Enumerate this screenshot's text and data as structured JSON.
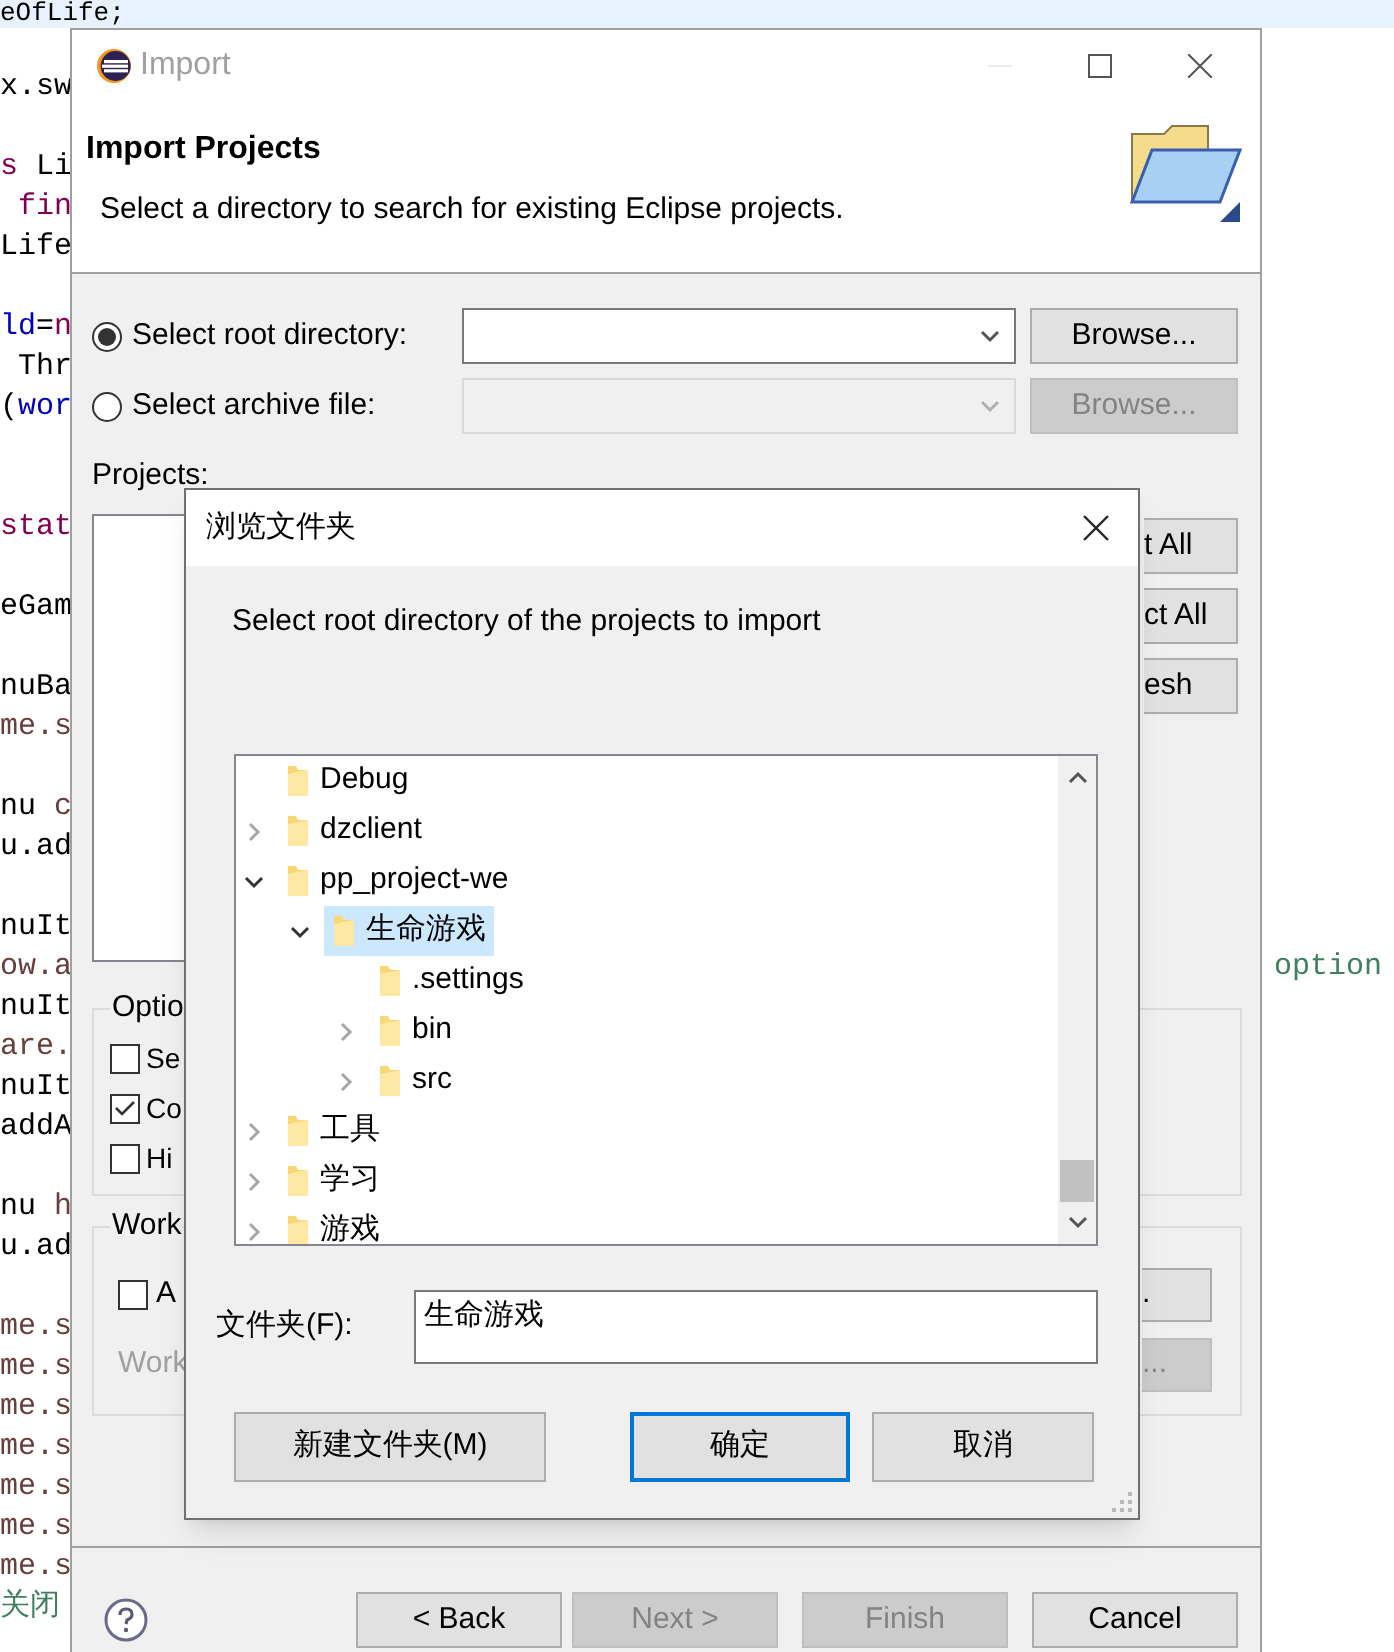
{
  "editor": {
    "lines": [
      {
        "kind": "code",
        "highlighted": true,
        "tokens": [
          {
            "text": "eOfLife;",
            "color": "#000000"
          }
        ]
      },
      {
        "kind": "blank"
      },
      {
        "kind": "code",
        "highlighted": false,
        "tokens": [
          {
            "text": "x.sw",
            "color": "#000000"
          }
        ]
      },
      {
        "kind": "blank"
      },
      {
        "kind": "code",
        "highlighted": false,
        "tokens": [
          {
            "text": "s",
            "color": "#7f0055"
          },
          {
            "text": " Li",
            "color": "#000000"
          }
        ]
      },
      {
        "kind": "code",
        "highlighted": false,
        "tokens": [
          {
            "text": " fin",
            "color": "#7f0055"
          }
        ]
      },
      {
        "kind": "code",
        "highlighted": false,
        "tokens": [
          {
            "text": "Life",
            "color": "#000000"
          }
        ]
      },
      {
        "kind": "blank"
      },
      {
        "kind": "code",
        "highlighted": false,
        "tokens": [
          {
            "text": "ld",
            "color": "#0000c0"
          },
          {
            "text": "=",
            "color": "#000000"
          },
          {
            "text": "n",
            "color": "#7f0055"
          }
        ]
      },
      {
        "kind": "code",
        "highlighted": false,
        "tokens": [
          {
            "text": " Thr",
            "color": "#000000"
          }
        ]
      },
      {
        "kind": "code",
        "highlighted": false,
        "tokens": [
          {
            "text": "(",
            "color": "#000000"
          },
          {
            "text": "wor",
            "color": "#0000c0"
          }
        ]
      },
      {
        "kind": "blank"
      },
      {
        "kind": "blank"
      },
      {
        "kind": "code",
        "highlighted": false,
        "tokens": [
          {
            "text": "stat",
            "color": "#7f0055"
          }
        ]
      },
      {
        "kind": "blank"
      },
      {
        "kind": "code",
        "highlighted": false,
        "tokens": [
          {
            "text": "eGam",
            "color": "#000000"
          }
        ]
      },
      {
        "kind": "blank"
      },
      {
        "kind": "code",
        "highlighted": false,
        "tokens": [
          {
            "text": "nuBa",
            "color": "#000000"
          }
        ]
      },
      {
        "kind": "code",
        "highlighted": false,
        "tokens": [
          {
            "text": "me.s",
            "color": "#6a3e3e"
          }
        ]
      },
      {
        "kind": "blank"
      },
      {
        "kind": "code",
        "highlighted": false,
        "tokens": [
          {
            "text": "nu",
            "color": "#000000"
          },
          {
            "text": " c",
            "color": "#6a3e3e"
          }
        ]
      },
      {
        "kind": "code",
        "highlighted": false,
        "tokens": [
          {
            "text": "u.ad",
            "color": "#000000"
          }
        ]
      },
      {
        "kind": "blank"
      },
      {
        "kind": "code",
        "highlighted": false,
        "tokens": [
          {
            "text": "nuIt",
            "color": "#000000"
          }
        ]
      },
      {
        "kind": "code",
        "highlighted": false,
        "tokens": [
          {
            "text": "ow.a",
            "color": "#6a3e3e"
          }
        ],
        "right_tokens": [
          {
            "text": "option",
            "color": "#3f7f5f"
          }
        ]
      },
      {
        "kind": "code",
        "highlighted": false,
        "tokens": [
          {
            "text": "nuIt",
            "color": "#000000"
          }
        ]
      },
      {
        "kind": "code",
        "highlighted": false,
        "tokens": [
          {
            "text": "are.",
            "color": "#6a3e3e"
          }
        ]
      },
      {
        "kind": "code",
        "highlighted": false,
        "tokens": [
          {
            "text": "nuIt",
            "color": "#000000"
          }
        ]
      },
      {
        "kind": "code",
        "highlighted": false,
        "tokens": [
          {
            "text": "addA",
            "color": "#000000"
          }
        ]
      },
      {
        "kind": "blank"
      },
      {
        "kind": "code",
        "highlighted": false,
        "tokens": [
          {
            "text": "nu",
            "color": "#000000"
          },
          {
            "text": " h",
            "color": "#6a3e3e"
          }
        ]
      },
      {
        "kind": "code",
        "highlighted": false,
        "tokens": [
          {
            "text": "u.ad",
            "color": "#000000"
          }
        ]
      },
      {
        "kind": "blank"
      },
      {
        "kind": "code",
        "highlighted": false,
        "tokens": [
          {
            "text": "me.s",
            "color": "#6a3e3e"
          }
        ]
      },
      {
        "kind": "code",
        "highlighted": false,
        "tokens": [
          {
            "text": "me.s",
            "color": "#6a3e3e"
          }
        ]
      },
      {
        "kind": "code",
        "highlighted": false,
        "tokens": [
          {
            "text": "me.s",
            "color": "#6a3e3e"
          }
        ]
      },
      {
        "kind": "code",
        "highlighted": false,
        "tokens": [
          {
            "text": "me.s",
            "color": "#6a3e3e"
          }
        ]
      },
      {
        "kind": "code",
        "highlighted": false,
        "tokens": [
          {
            "text": "me.s",
            "color": "#6a3e3e"
          }
        ]
      },
      {
        "kind": "code",
        "highlighted": false,
        "tokens": [
          {
            "text": "me.s",
            "color": "#6a3e3e"
          }
        ]
      },
      {
        "kind": "code",
        "highlighted": false,
        "tokens": [
          {
            "text": "me.s",
            "color": "#6a3e3e"
          }
        ]
      },
      {
        "kind": "code",
        "highlighted": false,
        "tokens": [
          {
            "text": "关闭",
            "color": "#3f7f5f"
          }
        ]
      }
    ]
  },
  "import_dialog": {
    "title": "Import",
    "header": {
      "title": "Import Projects",
      "subtitle": "Select a directory to search for existing Eclipse projects."
    },
    "sources": [
      {
        "label": "Select root directory:",
        "selected": true,
        "disabled": false,
        "button": "Browse..."
      },
      {
        "label": "Select archive file:",
        "selected": false,
        "disabled": true,
        "button": "Browse..."
      }
    ],
    "projects_label": "Projects:",
    "side_buttons": [
      "t All",
      "ct All",
      "esh"
    ],
    "options": {
      "legend": "Optio",
      "items": [
        {
          "label": "Se",
          "checked": false
        },
        {
          "label": "Co",
          "checked": true
        },
        {
          "label": "Hi",
          "checked": false
        }
      ]
    },
    "working_sets": {
      "legend": "Work",
      "checkbox": {
        "label": "A",
        "checked": false
      },
      "label": "Work",
      "label_disabled": true,
      "buttons": [
        {
          "label": ".",
          "disabled": false
        },
        {
          "label": "...",
          "disabled": true
        }
      ]
    },
    "footer_buttons": [
      {
        "label": "< Back",
        "disabled": false
      },
      {
        "label": "Next >",
        "disabled": true
      },
      {
        "label": "Finish",
        "disabled": true
      },
      {
        "label": "Cancel",
        "disabled": false
      }
    ]
  },
  "folder_dialog": {
    "title": "浏览文件夹",
    "prompt": "Select root directory of the projects to import",
    "tree": [
      {
        "label": "Debug",
        "kind": "leaf",
        "selected": false
      },
      {
        "label": "dzclient",
        "kind": "branch",
        "expanded": false,
        "selected": false
      },
      {
        "label": "pp_project-we",
        "kind": "branch",
        "expanded": true,
        "selected": false,
        "children": [
          {
            "label": "生命游戏",
            "kind": "branch",
            "expanded": true,
            "selected": true,
            "children": [
              {
                "label": ".settings",
                "kind": "leaf",
                "selected": false
              },
              {
                "label": "bin",
                "kind": "branch",
                "expanded": false,
                "selected": false
              },
              {
                "label": "src",
                "kind": "branch",
                "expanded": false,
                "selected": false
              }
            ]
          }
        ]
      },
      {
        "label": "工具",
        "kind": "branch",
        "expanded": false,
        "selected": false
      },
      {
        "label": "学习",
        "kind": "branch",
        "expanded": false,
        "selected": false
      },
      {
        "label": "游戏",
        "kind": "branch",
        "expanded": false,
        "selected": false
      }
    ],
    "folder_label": "文件夹(F):",
    "folder_value": "生命游戏",
    "buttons": [
      {
        "label": "新建文件夹(M)",
        "default": false
      },
      {
        "label": "确定",
        "default": true
      },
      {
        "label": "取消",
        "default": false
      }
    ]
  }
}
